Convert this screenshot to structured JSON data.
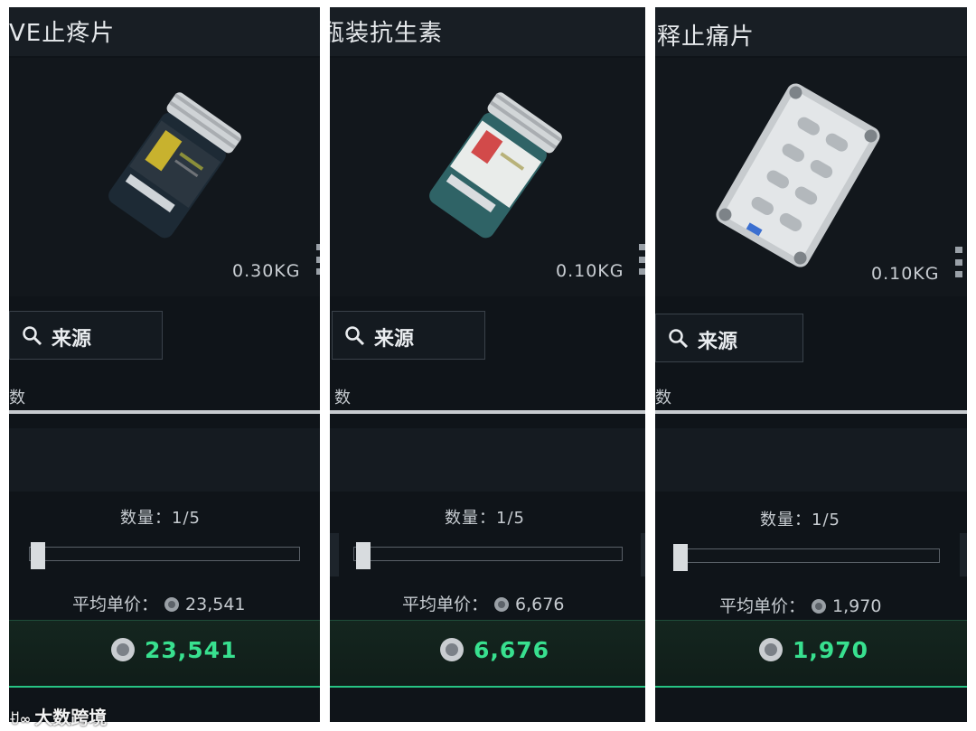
{
  "panels": [
    {
      "title": "VE止疼片",
      "weight": "0.30KG",
      "source_label": "来源",
      "section_label": "数",
      "quantity_text": "数量：1/5",
      "avg_price_label": "平均单价：",
      "avg_price": "23,541",
      "total_price": "23,541",
      "item_image": "pill-bottle-dark",
      "quantity": {
        "current": 1,
        "max": 5
      }
    },
    {
      "title": "瓶装抗生素",
      "weight": "0.10KG",
      "source_label": "来源",
      "section_label": "数",
      "quantity_text": "数量：1/5",
      "avg_price_label": "平均单价：",
      "avg_price": "6,676",
      "total_price": "6,676",
      "item_image": "pill-bottle-teal",
      "quantity": {
        "current": 1,
        "max": 5
      }
    },
    {
      "title": "释止痛片",
      "weight": "0.10KG",
      "source_label": "来源",
      "section_label": "数",
      "quantity_text": "数量：1/5",
      "avg_price_label": "平均单价：",
      "avg_price": "1,970",
      "total_price": "1,970",
      "item_image": "blister-pack",
      "quantity": {
        "current": 1,
        "max": 5
      }
    }
  ],
  "watermark": {
    "logo": "ꀀ∞",
    "text": "大数跨境"
  },
  "colors": {
    "accent_green": "#38e08f",
    "panel_bg": "#0f1419",
    "divider": "#c7cbcf"
  },
  "icons": {
    "search": "search-icon",
    "coin": "coin-icon"
  }
}
